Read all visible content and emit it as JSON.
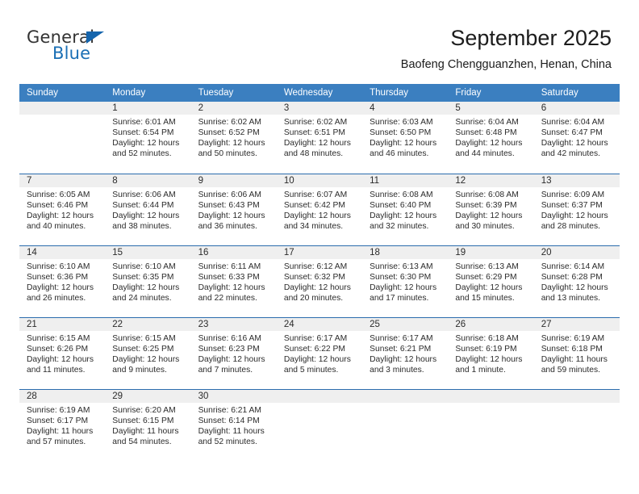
{
  "brand": {
    "name_part1": "General",
    "name_part2": "Blue",
    "triangle_color": "#1565ad"
  },
  "header": {
    "title": "September 2025",
    "subtitle": "Baofeng Chengguanzhen, Henan, China"
  },
  "theme": {
    "header_row_bg": "#3b7fc0",
    "daynum_bg": "#efefef",
    "row_divider": "#2b6cad",
    "text": "#2b2b2b"
  },
  "columns": [
    "Sunday",
    "Monday",
    "Tuesday",
    "Wednesday",
    "Thursday",
    "Friday",
    "Saturday"
  ],
  "labels": {
    "sunrise": "Sunrise:",
    "sunset": "Sunset:",
    "daylight": "Daylight:"
  },
  "weeks": [
    [
      {
        "day": "",
        "sunrise": "",
        "sunset": "",
        "daylight": ""
      },
      {
        "day": "1",
        "sunrise": "Sunrise: 6:01 AM",
        "sunset": "Sunset: 6:54 PM",
        "daylight": "Daylight: 12 hours and 52 minutes."
      },
      {
        "day": "2",
        "sunrise": "Sunrise: 6:02 AM",
        "sunset": "Sunset: 6:52 PM",
        "daylight": "Daylight: 12 hours and 50 minutes."
      },
      {
        "day": "3",
        "sunrise": "Sunrise: 6:02 AM",
        "sunset": "Sunset: 6:51 PM",
        "daylight": "Daylight: 12 hours and 48 minutes."
      },
      {
        "day": "4",
        "sunrise": "Sunrise: 6:03 AM",
        "sunset": "Sunset: 6:50 PM",
        "daylight": "Daylight: 12 hours and 46 minutes."
      },
      {
        "day": "5",
        "sunrise": "Sunrise: 6:04 AM",
        "sunset": "Sunset: 6:48 PM",
        "daylight": "Daylight: 12 hours and 44 minutes."
      },
      {
        "day": "6",
        "sunrise": "Sunrise: 6:04 AM",
        "sunset": "Sunset: 6:47 PM",
        "daylight": "Daylight: 12 hours and 42 minutes."
      }
    ],
    [
      {
        "day": "7",
        "sunrise": "Sunrise: 6:05 AM",
        "sunset": "Sunset: 6:46 PM",
        "daylight": "Daylight: 12 hours and 40 minutes."
      },
      {
        "day": "8",
        "sunrise": "Sunrise: 6:06 AM",
        "sunset": "Sunset: 6:44 PM",
        "daylight": "Daylight: 12 hours and 38 minutes."
      },
      {
        "day": "9",
        "sunrise": "Sunrise: 6:06 AM",
        "sunset": "Sunset: 6:43 PM",
        "daylight": "Daylight: 12 hours and 36 minutes."
      },
      {
        "day": "10",
        "sunrise": "Sunrise: 6:07 AM",
        "sunset": "Sunset: 6:42 PM",
        "daylight": "Daylight: 12 hours and 34 minutes."
      },
      {
        "day": "11",
        "sunrise": "Sunrise: 6:08 AM",
        "sunset": "Sunset: 6:40 PM",
        "daylight": "Daylight: 12 hours and 32 minutes."
      },
      {
        "day": "12",
        "sunrise": "Sunrise: 6:08 AM",
        "sunset": "Sunset: 6:39 PM",
        "daylight": "Daylight: 12 hours and 30 minutes."
      },
      {
        "day": "13",
        "sunrise": "Sunrise: 6:09 AM",
        "sunset": "Sunset: 6:37 PM",
        "daylight": "Daylight: 12 hours and 28 minutes."
      }
    ],
    [
      {
        "day": "14",
        "sunrise": "Sunrise: 6:10 AM",
        "sunset": "Sunset: 6:36 PM",
        "daylight": "Daylight: 12 hours and 26 minutes."
      },
      {
        "day": "15",
        "sunrise": "Sunrise: 6:10 AM",
        "sunset": "Sunset: 6:35 PM",
        "daylight": "Daylight: 12 hours and 24 minutes."
      },
      {
        "day": "16",
        "sunrise": "Sunrise: 6:11 AM",
        "sunset": "Sunset: 6:33 PM",
        "daylight": "Daylight: 12 hours and 22 minutes."
      },
      {
        "day": "17",
        "sunrise": "Sunrise: 6:12 AM",
        "sunset": "Sunset: 6:32 PM",
        "daylight": "Daylight: 12 hours and 20 minutes."
      },
      {
        "day": "18",
        "sunrise": "Sunrise: 6:13 AM",
        "sunset": "Sunset: 6:30 PM",
        "daylight": "Daylight: 12 hours and 17 minutes."
      },
      {
        "day": "19",
        "sunrise": "Sunrise: 6:13 AM",
        "sunset": "Sunset: 6:29 PM",
        "daylight": "Daylight: 12 hours and 15 minutes."
      },
      {
        "day": "20",
        "sunrise": "Sunrise: 6:14 AM",
        "sunset": "Sunset: 6:28 PM",
        "daylight": "Daylight: 12 hours and 13 minutes."
      }
    ],
    [
      {
        "day": "21",
        "sunrise": "Sunrise: 6:15 AM",
        "sunset": "Sunset: 6:26 PM",
        "daylight": "Daylight: 12 hours and 11 minutes."
      },
      {
        "day": "22",
        "sunrise": "Sunrise: 6:15 AM",
        "sunset": "Sunset: 6:25 PM",
        "daylight": "Daylight: 12 hours and 9 minutes."
      },
      {
        "day": "23",
        "sunrise": "Sunrise: 6:16 AM",
        "sunset": "Sunset: 6:23 PM",
        "daylight": "Daylight: 12 hours and 7 minutes."
      },
      {
        "day": "24",
        "sunrise": "Sunrise: 6:17 AM",
        "sunset": "Sunset: 6:22 PM",
        "daylight": "Daylight: 12 hours and 5 minutes."
      },
      {
        "day": "25",
        "sunrise": "Sunrise: 6:17 AM",
        "sunset": "Sunset: 6:21 PM",
        "daylight": "Daylight: 12 hours and 3 minutes."
      },
      {
        "day": "26",
        "sunrise": "Sunrise: 6:18 AM",
        "sunset": "Sunset: 6:19 PM",
        "daylight": "Daylight: 12 hours and 1 minute."
      },
      {
        "day": "27",
        "sunrise": "Sunrise: 6:19 AM",
        "sunset": "Sunset: 6:18 PM",
        "daylight": "Daylight: 11 hours and 59 minutes."
      }
    ],
    [
      {
        "day": "28",
        "sunrise": "Sunrise: 6:19 AM",
        "sunset": "Sunset: 6:17 PM",
        "daylight": "Daylight: 11 hours and 57 minutes."
      },
      {
        "day": "29",
        "sunrise": "Sunrise: 6:20 AM",
        "sunset": "Sunset: 6:15 PM",
        "daylight": "Daylight: 11 hours and 54 minutes."
      },
      {
        "day": "30",
        "sunrise": "Sunrise: 6:21 AM",
        "sunset": "Sunset: 6:14 PM",
        "daylight": "Daylight: 11 hours and 52 minutes."
      },
      {
        "day": "",
        "sunrise": "",
        "sunset": "",
        "daylight": ""
      },
      {
        "day": "",
        "sunrise": "",
        "sunset": "",
        "daylight": ""
      },
      {
        "day": "",
        "sunrise": "",
        "sunset": "",
        "daylight": ""
      },
      {
        "day": "",
        "sunrise": "",
        "sunset": "",
        "daylight": ""
      }
    ]
  ]
}
